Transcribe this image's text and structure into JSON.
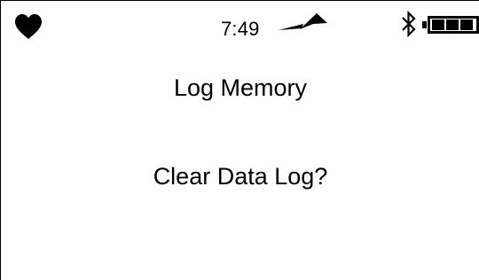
{
  "status_bar": {
    "time": "7:49",
    "icons": [
      "heart-icon",
      "signal-icon",
      "bluetooth-icon",
      "battery-icon"
    ],
    "battery_level": 1.0
  },
  "screen": {
    "title": "Log Memory",
    "prompt": "Clear Data Log?"
  },
  "colors": {
    "foreground": "#000000",
    "background": "#ffffff"
  }
}
